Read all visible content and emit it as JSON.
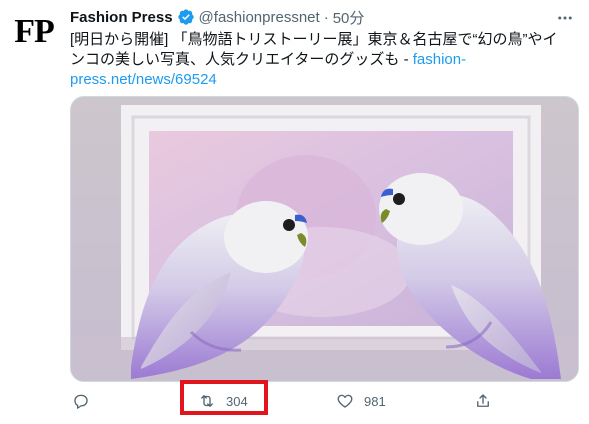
{
  "author": {
    "avatar_text": "FP",
    "display_name": "Fashion Press",
    "handle": "@fashionpressnet",
    "separator": "·",
    "timestamp": "50分",
    "verified": true
  },
  "tweet": {
    "text": "[明日から開催] 「鳥物語トリストーリー展」東京＆名古屋で“幻の鳥”やインコの美しい写真、人気クリエイターのグッズも - ",
    "link": "fashion-press.net/news/69524"
  },
  "actions": {
    "reply_count": "",
    "retweet_count": "304",
    "like_count": "981"
  },
  "icons": {
    "verified": "verified-badge-icon",
    "more": "more-options-icon",
    "reply": "reply-icon",
    "retweet": "retweet-icon",
    "like": "heart-icon",
    "share": "share-icon"
  },
  "colors": {
    "link": "#1d9bf0",
    "secondary_text": "#536471",
    "highlight_box": "#e0151d",
    "budgie_purple": "#a98fd6"
  }
}
